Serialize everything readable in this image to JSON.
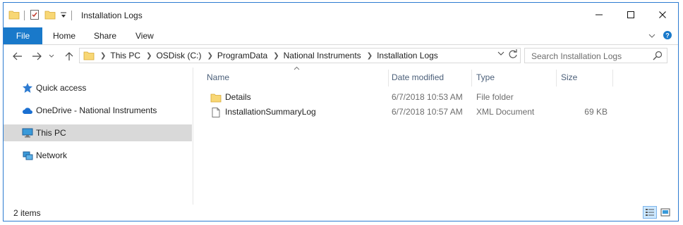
{
  "window": {
    "title": "Installation Logs",
    "controls": {
      "minimize": "—",
      "maximize": "☐",
      "close": "✕"
    }
  },
  "ribbon": {
    "tabs": {
      "file": "File",
      "home": "Home",
      "share": "Share",
      "view": "View"
    }
  },
  "nav": {
    "breadcrumb": [
      "This PC",
      "OSDisk (C:)",
      "ProgramData",
      "National Instruments",
      "Installation Logs"
    ],
    "search_placeholder": "Search Installation Logs"
  },
  "sidebar": {
    "items": [
      {
        "label": "Quick access",
        "icon": "star-icon",
        "selected": false
      },
      {
        "label": "OneDrive - National Instruments",
        "icon": "cloud-icon",
        "selected": false
      },
      {
        "label": "This PC",
        "icon": "monitor-icon",
        "selected": true
      },
      {
        "label": "Network",
        "icon": "network-icon",
        "selected": false
      }
    ]
  },
  "filelist": {
    "columns": {
      "name": "Name",
      "date": "Date modified",
      "type": "Type",
      "size": "Size"
    },
    "rows": [
      {
        "name": "Details",
        "date": "6/7/2018 10:53 AM",
        "type": "File folder",
        "size": "",
        "icon": "folder-icon"
      },
      {
        "name": "InstallationSummaryLog",
        "date": "6/7/2018 10:57 AM",
        "type": "XML Document",
        "size": "69 KB",
        "icon": "document-icon"
      }
    ]
  },
  "status": {
    "item_count": "2 items"
  },
  "colors": {
    "accent": "#1979ca",
    "folder": "#f8d775",
    "selected_bg": "#d9d9d9",
    "header_text": "#4c607a"
  }
}
